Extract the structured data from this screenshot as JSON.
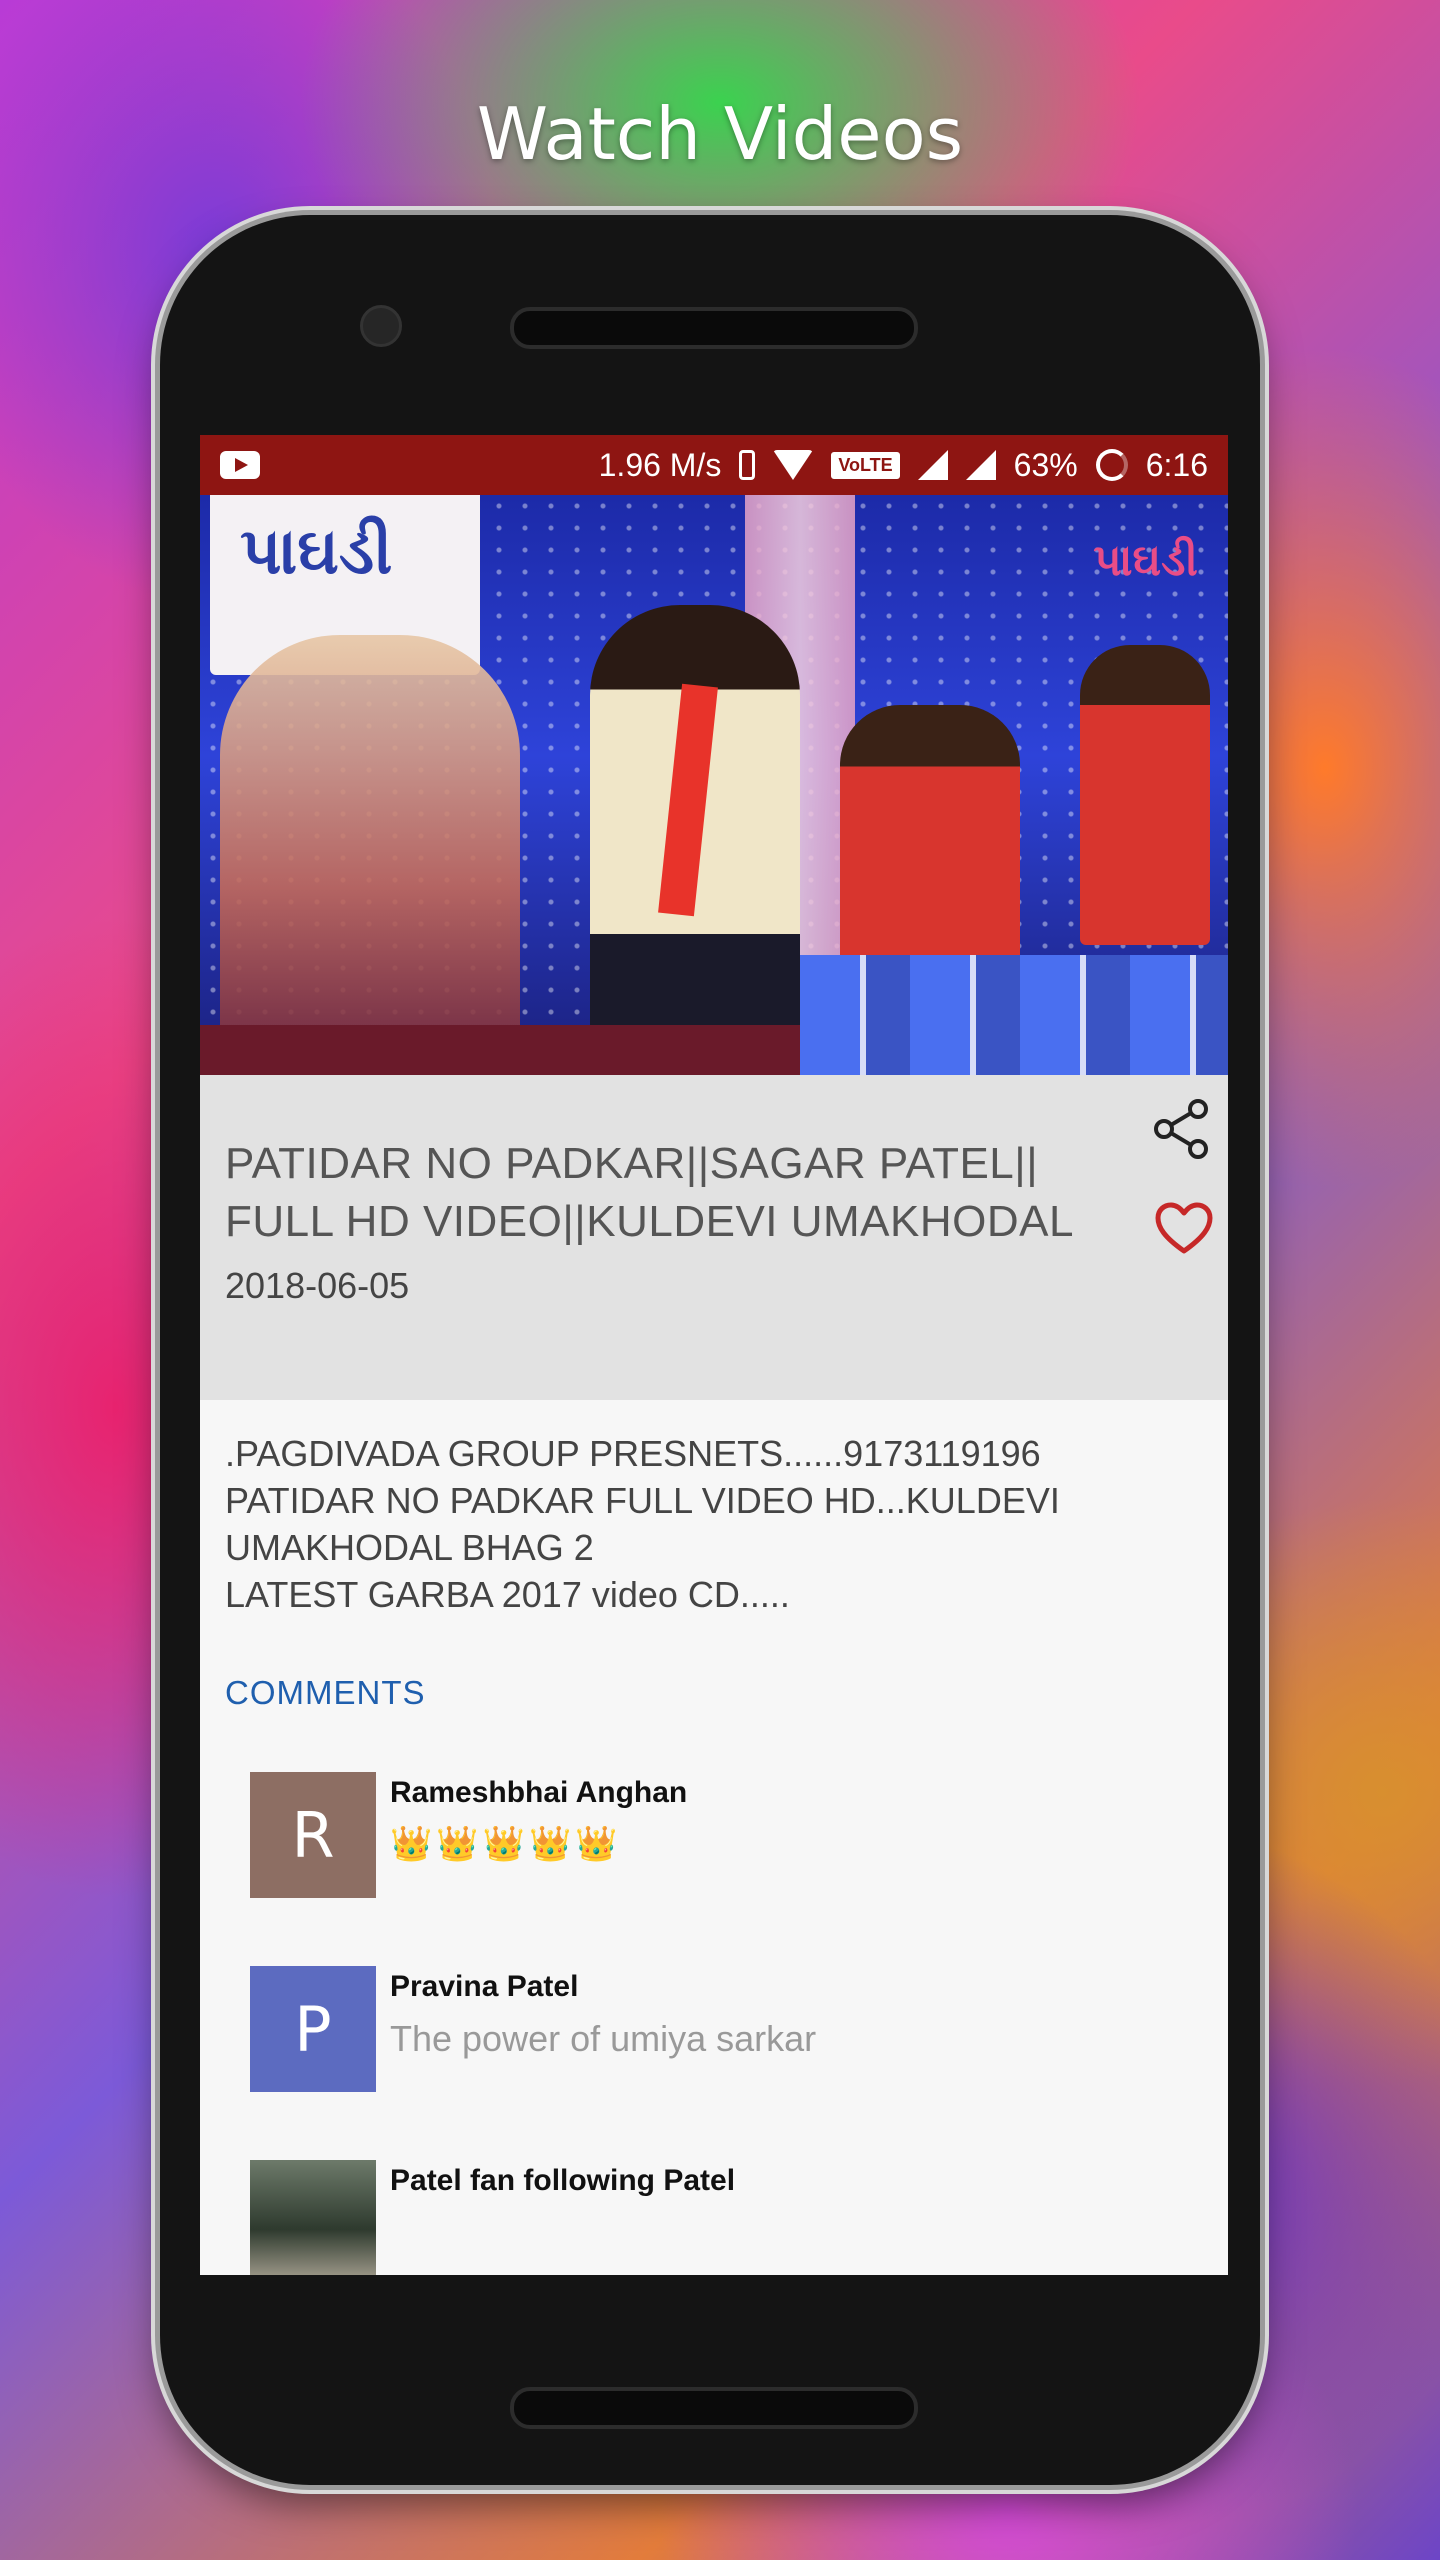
{
  "headline": "Watch Videos",
  "status_bar": {
    "speed": "1.96 M/s",
    "volte": "VoLTE",
    "battery": "63%",
    "time": "6:16"
  },
  "video": {
    "thumbnail_banner_text": "પાઘડી",
    "thumbnail_logo_text": "પાઘડી"
  },
  "details": {
    "title": "PATIDAR NO PADKAR||SAGAR PATEL|| FULL HD VIDEO||KULDEVI UMAKHODAL",
    "date": "2018-06-05",
    "description": ".PAGDIVADA GROUP PRESNETS......9173119196\nPATIDAR NO PADKAR FULL VIDEO HD...KULDEVI UMAKHODAL BHAG 2\nLATEST GARBA 2017 video CD....."
  },
  "comments_label": "COMMENTS",
  "comments": [
    {
      "initial": "R",
      "name": "Rameshbhai Anghan",
      "text": "👑👑👑👑👑",
      "avatar_color": "#8d6e63"
    },
    {
      "initial": "P",
      "name": "Pravina Patel",
      "text": "The power of umiya sarkar",
      "avatar_color": "#5c6bc0"
    },
    {
      "initial": "",
      "name": "Patel fan following Patel",
      "text": ""
    }
  ],
  "icons": {
    "share": "share-icon",
    "favorite": "heart-icon",
    "youtube": "youtube-icon"
  },
  "colors": {
    "status_bar": "#8e1512",
    "comments_accent": "#1f5fae",
    "heart": "#c62828"
  }
}
